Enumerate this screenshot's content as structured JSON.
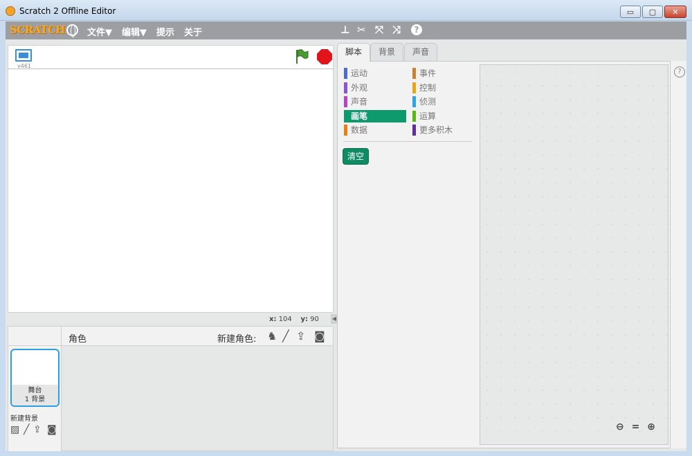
{
  "window": {
    "title": "Scratch 2 Offline Editor",
    "minimize": "▭",
    "maximize": "▢",
    "close": "✕"
  },
  "menubar": {
    "logo": "SCRATCH",
    "file": "文件▼",
    "edit": "编辑▼",
    "tips": "提示",
    "about": "关于",
    "help": "?"
  },
  "stage": {
    "version": "v461",
    "x_label": "x:",
    "x_value": "104",
    "y_label": "y:",
    "y_value": "90"
  },
  "sprites": {
    "label": "角色",
    "new_sprite_label": "新建角色:",
    "stage_name": "舞台",
    "backdrop_count": "1 背景",
    "new_backdrop_label": "新建背景"
  },
  "tabs": [
    "脚本",
    "背景",
    "声音"
  ],
  "categories": [
    {
      "label": "运动",
      "color": "#4a6cd4"
    },
    {
      "label": "外观",
      "color": "#8a55d7"
    },
    {
      "label": "声音",
      "color": "#bb42c3"
    },
    {
      "label": "画笔",
      "color": "#0e9a6c"
    },
    {
      "label": "数据",
      "color": "#ee7d16"
    },
    {
      "label": "事件",
      "color": "#c88330"
    },
    {
      "label": "控制",
      "color": "#e1a91a"
    },
    {
      "label": "侦测",
      "color": "#2ca5e2"
    },
    {
      "label": "运算",
      "color": "#5cb712"
    },
    {
      "label": "更多积木",
      "color": "#632d99"
    }
  ],
  "selected_category": "画笔",
  "blocks": {
    "clear": "清空"
  }
}
